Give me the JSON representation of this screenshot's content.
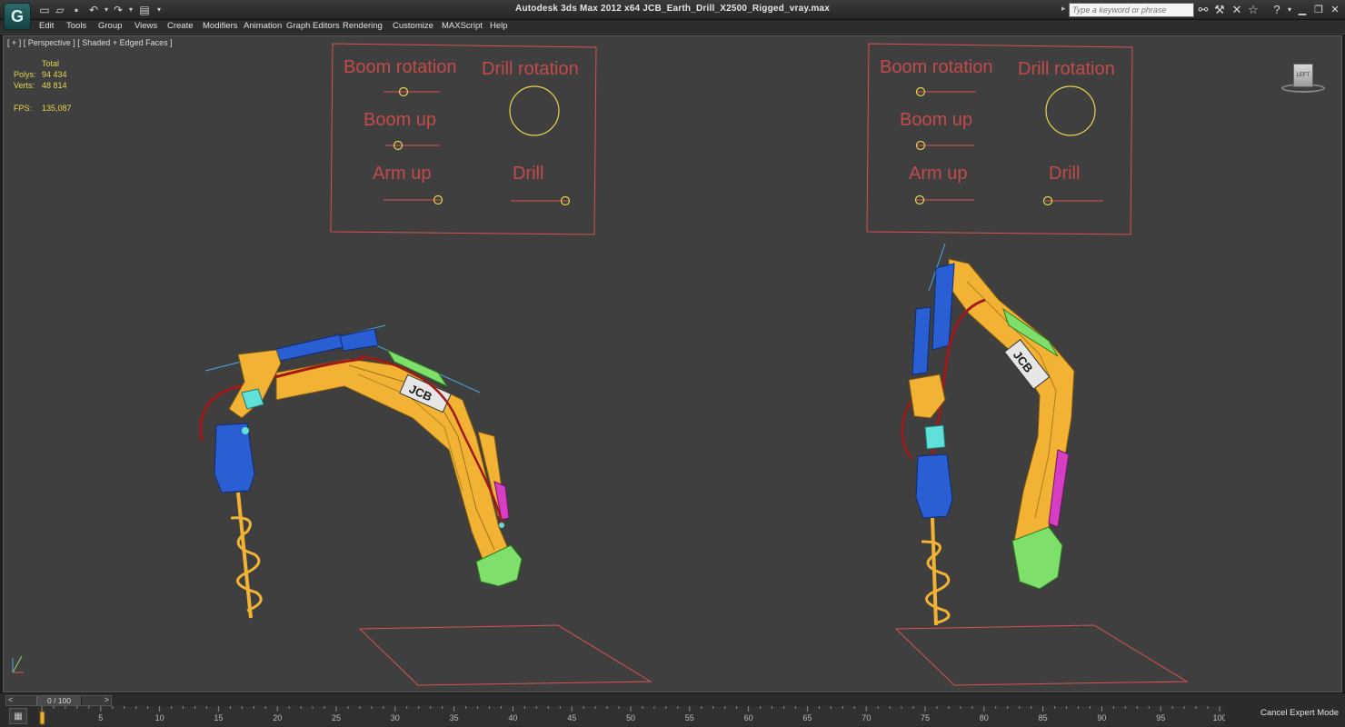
{
  "app": {
    "title": "Autodesk 3ds Max  2012 x64     JCB_Earth_Drill_X2500_Rigged_vray.max",
    "logo_label": "G",
    "search_placeholder": "Type a keyword or phrase"
  },
  "quick_access": [
    {
      "name": "new-file-icon",
      "glyph": "▭"
    },
    {
      "name": "open-file-icon",
      "glyph": "▱"
    },
    {
      "name": "save-icon",
      "glyph": "▪"
    },
    {
      "name": "undo-icon",
      "glyph": "↶"
    },
    {
      "name": "redo-icon",
      "glyph": "↷"
    },
    {
      "name": "project-folder-icon",
      "glyph": "▤"
    }
  ],
  "menu": [
    "Edit",
    "Tools",
    "Group",
    "Views",
    "Create",
    "Modifiers",
    "Animation",
    "Graph Editors",
    "Rendering",
    "Customize",
    "MAXScript",
    "Help"
  ],
  "viewport": {
    "label": "[ + ] [ Perspective ] [ Shaded + Edged Faces ]",
    "stats": {
      "total_label": "Total",
      "polys_label": "Polys:",
      "polys_value": "94 434",
      "verts_label": "Verts:",
      "verts_value": "48 814",
      "fps_label": "FPS:",
      "fps_value": "135,087"
    },
    "viewcube_label": "LEFT",
    "rig_panel": {
      "boom_rotation": "Boom rotation",
      "drill_rotation": "Drill rotation",
      "boom_up": "Boom up",
      "arm_up": "Arm  up",
      "drill": "Drill"
    },
    "colors": {
      "background": "#3f3f3f",
      "rig_lines": "#d9534f",
      "slider_knob": "#e8d44d",
      "boom": "#f2b335",
      "cylinder": "#2a5fd4",
      "hose": "#a01818",
      "bucket": "#7ee06a",
      "accent_cyan": "#5fe0d8"
    }
  },
  "timeline": {
    "slider_label": "0 / 100",
    "ticks": [
      "0",
      "5",
      "10",
      "15",
      "20",
      "25",
      "30",
      "35",
      "40",
      "45",
      "50",
      "55",
      "60",
      "65",
      "70",
      "75",
      "80",
      "85",
      "90",
      "95",
      "100"
    ],
    "cancel_label": "Cancel Expert Mode"
  }
}
